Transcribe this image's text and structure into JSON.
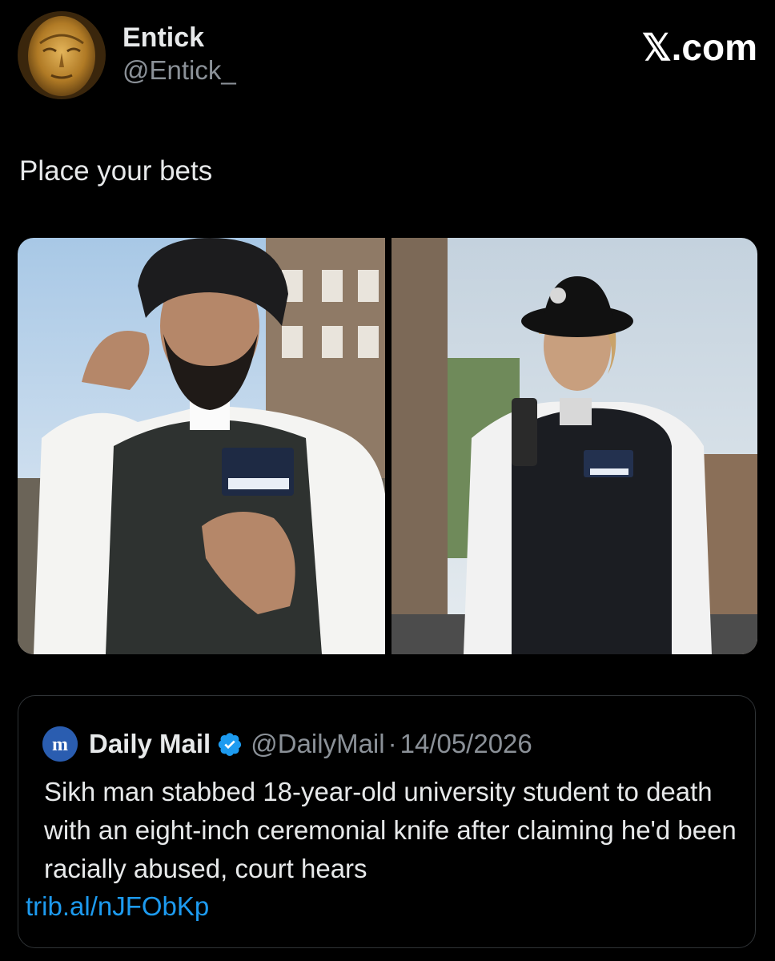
{
  "author": {
    "display_name": "Entick",
    "handle": "@Entick_"
  },
  "site_badge": "𝕏.com",
  "tweet": {
    "text": "Place your bets"
  },
  "media": {
    "icons": [
      "left-photo-police-officer-turban",
      "right-photo-police-officer-hat"
    ]
  },
  "quote": {
    "author_name": "Daily Mail",
    "handle": "@DailyMail",
    "separator": "·",
    "date": "14/05/2026",
    "text": "Sikh man stabbed 18-year-old university student to death with an eight-inch ceremonial knife after claiming he'd been racially abused, court hears",
    "link": "trib.al/nJFObKp"
  },
  "colors": {
    "background": "#000000",
    "text": "#e7e9ea",
    "secondary": "#8b9198",
    "link": "#1d9bf0",
    "border": "#2f3336",
    "verified": "#1d9bf0"
  }
}
